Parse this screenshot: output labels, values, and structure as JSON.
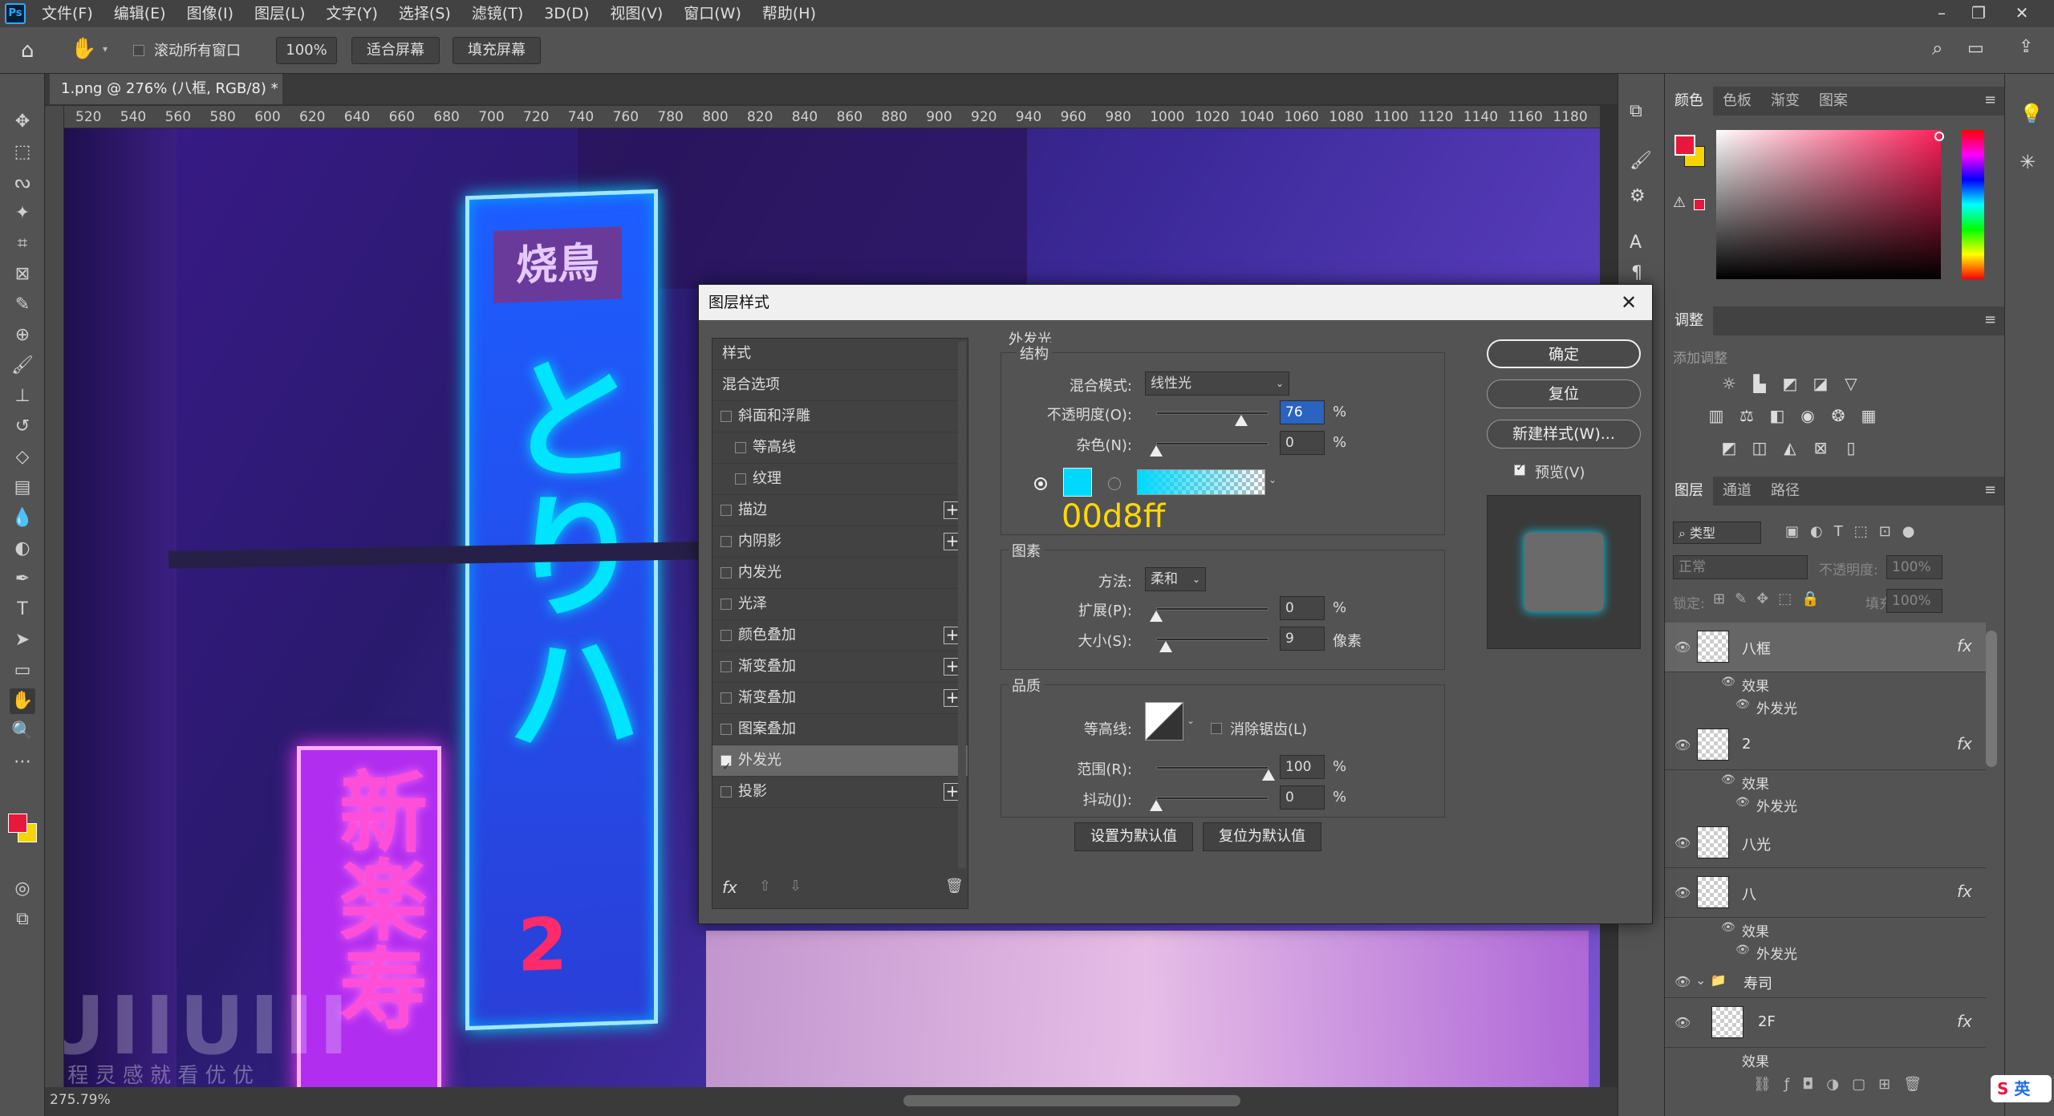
{
  "app": {
    "logo": "Ps"
  },
  "menu": [
    "文件(F)",
    "编辑(E)",
    "图像(I)",
    "图层(L)",
    "文字(Y)",
    "选择(S)",
    "滤镜(T)",
    "3D(D)",
    "视图(V)",
    "窗口(W)",
    "帮助(H)"
  ],
  "options": {
    "scroll_all": "滚动所有窗口",
    "zoom": "100%",
    "fit_screen": "适合屏幕",
    "fill_screen": "填充屏幕"
  },
  "document": {
    "tab_title": "1.png @ 276% (八框, RGB/8) *",
    "zoom_status": "275.79%"
  },
  "ruler_labels": [
    "520",
    "540",
    "560",
    "580",
    "600",
    "620",
    "640",
    "660",
    "680",
    "700",
    "720",
    "740",
    "760",
    "780",
    "800",
    "820",
    "840",
    "860",
    "880",
    "900",
    "920",
    "940",
    "960",
    "980",
    "1000",
    "1020",
    "1040",
    "1060",
    "1080",
    "1100",
    "1120",
    "1140",
    "1160",
    "1180"
  ],
  "canvas_text": {
    "sign_top": "烧鳥",
    "sign_big": "とりハ",
    "sign_num": "2",
    "sign_pink": "新楽寿",
    "watermark": "UIIUIII",
    "watermark_sub": "教 程 灵 感 就 看 优 优"
  },
  "dialog": {
    "title": "图层样式",
    "styles_header": "样式",
    "blend_options": "混合选项",
    "style_items": [
      {
        "label": "斜面和浮雕",
        "checked": false,
        "plus": false,
        "indent": false
      },
      {
        "label": "等高线",
        "checked": false,
        "plus": false,
        "indent": true
      },
      {
        "label": "纹理",
        "checked": false,
        "plus": false,
        "indent": true
      },
      {
        "label": "描边",
        "checked": false,
        "plus": true,
        "indent": false
      },
      {
        "label": "内阴影",
        "checked": false,
        "plus": true,
        "indent": false
      },
      {
        "label": "内发光",
        "checked": false,
        "plus": false,
        "indent": false
      },
      {
        "label": "光泽",
        "checked": false,
        "plus": false,
        "indent": false
      },
      {
        "label": "颜色叠加",
        "checked": false,
        "plus": true,
        "indent": false
      },
      {
        "label": "渐变叠加",
        "checked": false,
        "plus": true,
        "indent": false
      },
      {
        "label": "渐变叠加",
        "checked": false,
        "plus": true,
        "indent": false
      },
      {
        "label": "图案叠加",
        "checked": false,
        "plus": false,
        "indent": false
      },
      {
        "label": "外发光",
        "checked": true,
        "plus": false,
        "indent": false
      },
      {
        "label": "投影",
        "checked": false,
        "plus": true,
        "indent": false
      }
    ],
    "fx_label": "fx",
    "section_title": "外发光",
    "structure": {
      "title": "结构",
      "blend_mode_label": "混合模式:",
      "blend_mode_value": "线性光",
      "opacity_label": "不透明度(O):",
      "opacity_value": "76",
      "opacity_unit": "%",
      "opacity_pct": 76,
      "noise_label": "杂色(N):",
      "noise_value": "0",
      "noise_unit": "%",
      "glow_color": "#00d8ff",
      "color_annotation": "00d8ff"
    },
    "elements": {
      "title": "图素",
      "method_label": "方法:",
      "method_value": "柔和",
      "spread_label": "扩展(P):",
      "spread_value": "0",
      "spread_unit": "%",
      "size_label": "大小(S):",
      "size_value": "9",
      "size_unit": "像素"
    },
    "quality": {
      "title": "品质",
      "contour_label": "等高线:",
      "anti_alias_label": "消除锯齿(L)",
      "range_label": "范围(R):",
      "range_value": "100",
      "range_unit": "%",
      "jitter_label": "抖动(J):",
      "jitter_value": "0",
      "jitter_unit": "%"
    },
    "set_default": "设置为默认值",
    "reset_default": "复位为默认值",
    "ok": "确定",
    "reset": "复位",
    "new_style": "新建样式(W)...",
    "preview_label": "预览(V)"
  },
  "panels": {
    "color_tabs": [
      "颜色",
      "色板",
      "渐变",
      "图案"
    ],
    "adjust_tab": "调整",
    "adjust_add": "添加调整",
    "layer_tabs": [
      "图层",
      "通道",
      "路径"
    ],
    "kind_label": "类型",
    "blend_mode": "正常",
    "opacity_label": "不透明度:",
    "opacity_value": "100%",
    "lock_label": "锁定:",
    "fill_label": "填充:",
    "fill_value": "100%",
    "fg_color": "#e8173c",
    "bg_color": "#f5d400",
    "layers": [
      {
        "name": "八框",
        "fx": true,
        "selected": true,
        "effects": [
          "效果",
          "外发光"
        ]
      },
      {
        "name": "2",
        "fx": true,
        "selected": false,
        "effects": [
          "效果",
          "外发光"
        ]
      },
      {
        "name": "八光",
        "fx": false,
        "selected": false,
        "effects": []
      },
      {
        "name": "八",
        "fx": true,
        "selected": false,
        "effects": [
          "效果",
          "外发光"
        ]
      },
      {
        "name": "寿司",
        "fx": false,
        "selected": false,
        "group": true,
        "effects": []
      },
      {
        "name": "2F",
        "fx": true,
        "selected": false,
        "effects": [
          "效果"
        ]
      }
    ]
  },
  "ime": {
    "label": "英"
  }
}
